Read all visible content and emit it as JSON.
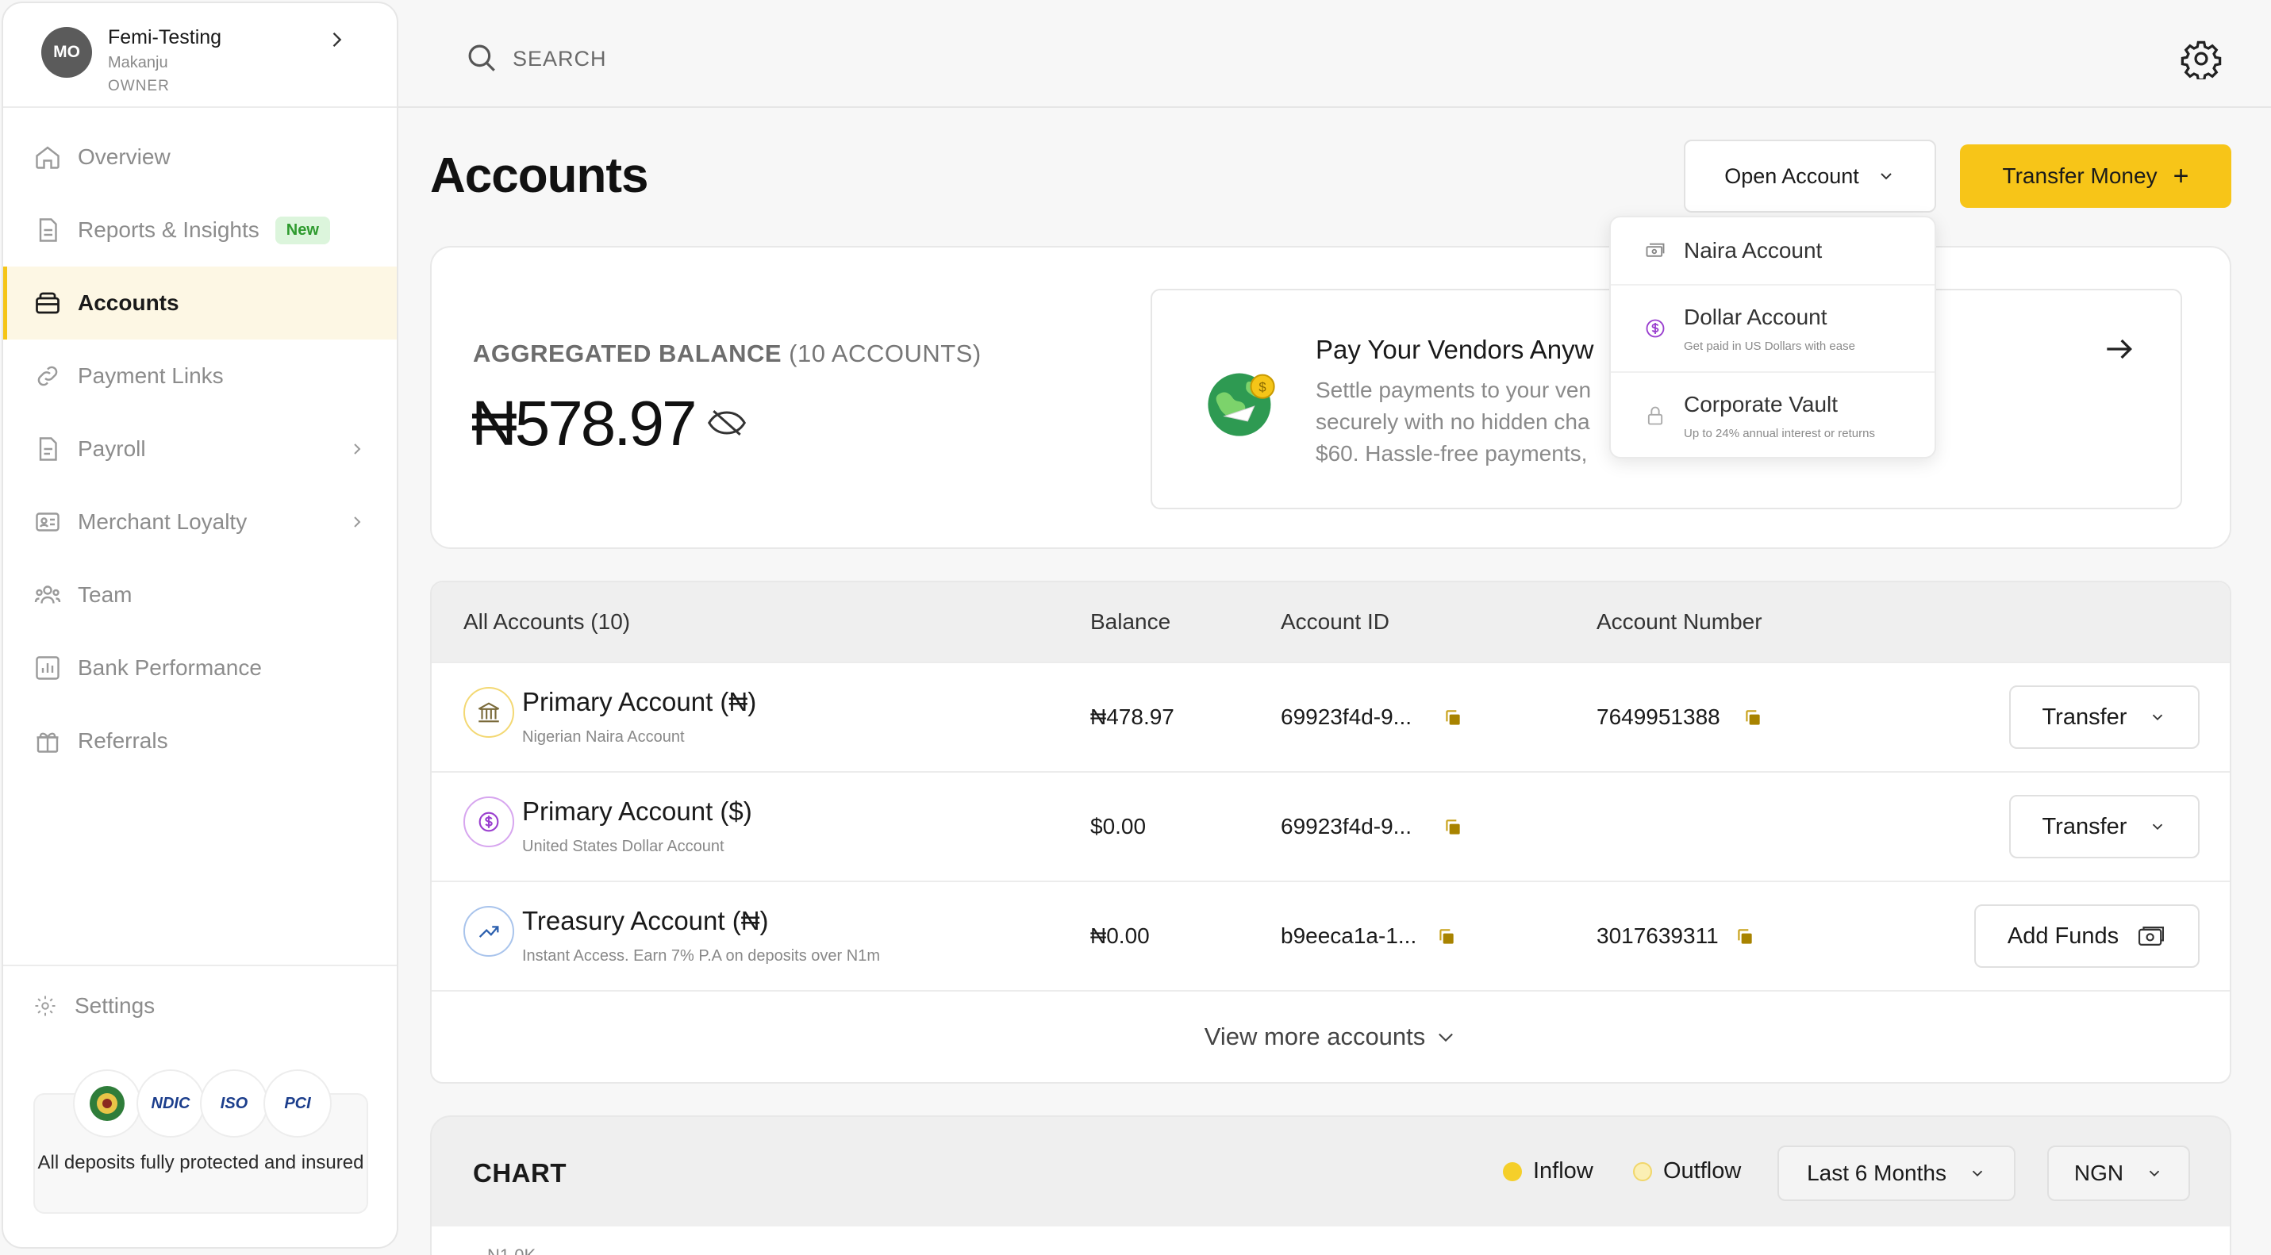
{
  "user": {
    "initials": "MO",
    "name": "Femi-Testing",
    "surname": "Makanju",
    "role": "OWNER"
  },
  "nav": {
    "overview": "Overview",
    "reports": "Reports & Insights",
    "reports_badge": "New",
    "accounts": "Accounts",
    "payment_links": "Payment Links",
    "payroll": "Payroll",
    "merchant_loyalty": "Merchant Loyalty",
    "team": "Team",
    "bank_performance": "Bank Performance",
    "referrals": "Referrals",
    "settings": "Settings"
  },
  "trust": {
    "logos": [
      "NDIC",
      "ISO",
      "PCI"
    ],
    "text": "All deposits fully protected and insured"
  },
  "search": {
    "placeholder": "SEARCH"
  },
  "header": {
    "title": "Accounts",
    "open_account": "Open Account",
    "transfer_money": "Transfer Money",
    "transfer_plus": "+"
  },
  "balance": {
    "label_bold": "AGGREGATED BALANCE",
    "label_count": "(10 ACCOUNTS)",
    "value": "₦578.97"
  },
  "promo": {
    "title": "Pay Your Vendors Anyw",
    "line1": "Settle payments to your ven",
    "line2": "securely with no hidden cha",
    "line3": "$60. Hassle-free payments,"
  },
  "dropdown": {
    "items": [
      {
        "title": "Naira Account",
        "subtitle": ""
      },
      {
        "title": "Dollar Account",
        "subtitle": "Get paid in US Dollars with ease"
      },
      {
        "title": "Corporate Vault",
        "subtitle": "Up to 24% annual interest or returns"
      }
    ]
  },
  "table": {
    "headers": {
      "all": "All Accounts (10)",
      "balance": "Balance",
      "account_id": "Account ID",
      "account_number": "Account Number"
    },
    "rows": [
      {
        "name": "Primary Account (₦)",
        "subtitle": "Nigerian Naira Account",
        "balance": "₦478.97",
        "account_id": "69923f4d-9...",
        "account_number": "7649951388",
        "action": "Transfer"
      },
      {
        "name": "Primary Account ($)",
        "subtitle": "United States Dollar Account",
        "balance": "$0.00",
        "account_id": "69923f4d-9...",
        "account_number": "",
        "action": "Transfer"
      },
      {
        "name": "Treasury Account (₦)",
        "subtitle": "Instant Access. Earn 7% P.A on deposits over N1m",
        "balance": "₦0.00",
        "account_id": "b9eeca1a-1...",
        "account_number": "3017639311",
        "action": "Add Funds"
      }
    ],
    "view_more": "View more accounts"
  },
  "chart": {
    "title": "CHART",
    "legend_inflow": "Inflow",
    "legend_outflow": "Outflow",
    "period": "Last 6 Months",
    "currency": "NGN",
    "y_tick": "N1.0K"
  },
  "colors": {
    "accent": "#f7c518",
    "inflow": "#f5cf2a",
    "outflow": "#fbefb4",
    "active_bg": "#fdf7e4",
    "badge_bg": "#dcf5dc",
    "badge_text": "#2e9b2e",
    "copy_icon": "#a88300"
  }
}
